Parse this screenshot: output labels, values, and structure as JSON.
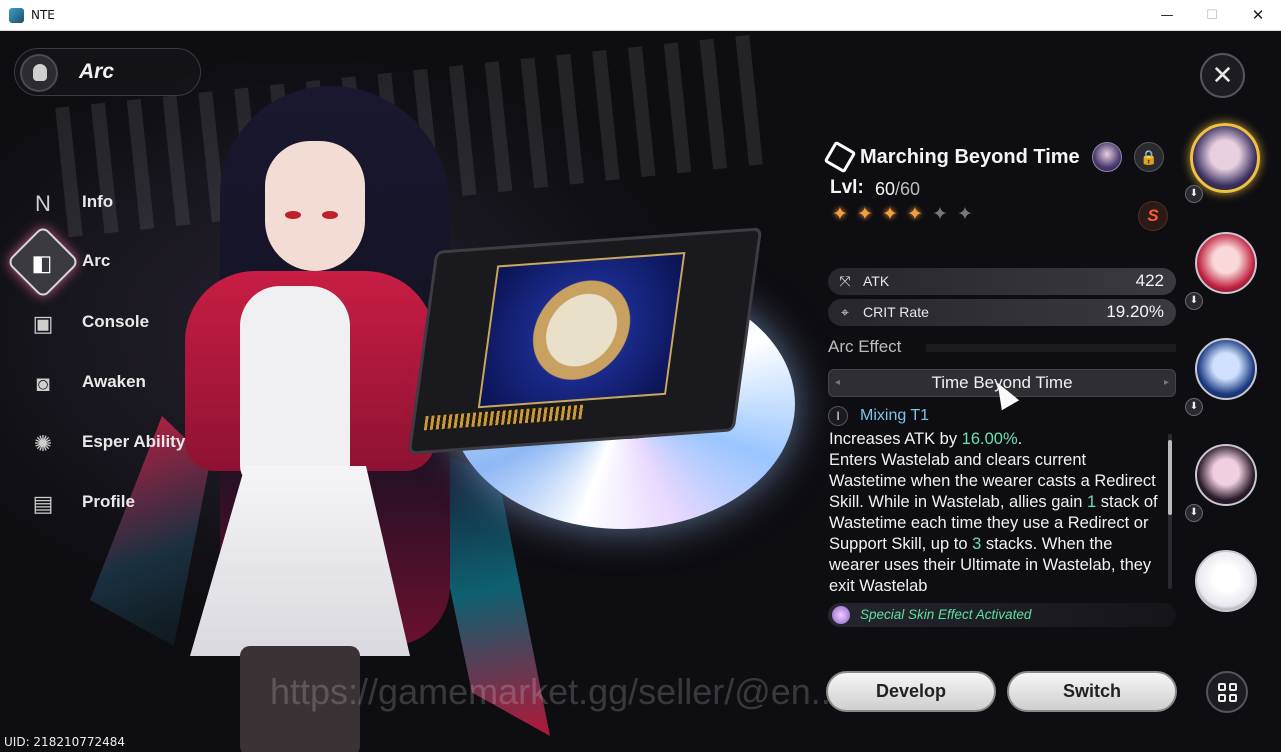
{
  "window": {
    "title": "NTE",
    "minimize": "—",
    "maximize": "☐",
    "close": "✕"
  },
  "character": {
    "name": "Arc"
  },
  "nav": [
    {
      "label": "Info",
      "icon": "info-icon",
      "glyph": "N"
    },
    {
      "label": "Arc",
      "icon": "arc-icon",
      "glyph": "◧"
    },
    {
      "label": "Console",
      "icon": "console-icon",
      "glyph": "▣"
    },
    {
      "label": "Awaken",
      "icon": "awaken-icon",
      "glyph": "◙"
    },
    {
      "label": "Esper Ability",
      "icon": "esper-icon",
      "glyph": "✺"
    },
    {
      "label": "Profile",
      "icon": "profile-icon",
      "glyph": "▤"
    }
  ],
  "arc": {
    "name": "Marching Beyond Time",
    "lvl_label": "Lvl:",
    "lvl_current": "60",
    "lvl_max": "/60",
    "stars_filled": 4,
    "stars_total": 6,
    "rank": "S",
    "lock_glyph": "🔒",
    "stats": [
      {
        "name": "ATK",
        "value": "422",
        "icon": "atk-icon",
        "glyph": "⤧"
      },
      {
        "name": "CRIT Rate",
        "value": "19.20%",
        "icon": "crit-icon",
        "glyph": "⌖"
      }
    ],
    "effect_title": "Arc Effect",
    "effect_name": "Time Beyond Time",
    "tier_glyph": "I",
    "tier_label": "Mixing T1",
    "effect_text_parts": [
      {
        "text": "Increases ATK by ",
        "hl": false
      },
      {
        "text": "16.00%",
        "hl": true
      },
      {
        "text": ".",
        "hl": false
      },
      {
        "text": "\nEnters Wastelab and clears current Wastetime when the wearer casts a Redirect Skill. While in Wastelab, allies gain ",
        "hl": false
      },
      {
        "text": "1",
        "hl": true
      },
      {
        "text": " stack of Wastetime each time they use a Redirect or Support Skill, up to ",
        "hl": false
      },
      {
        "text": "3",
        "hl": true
      },
      {
        "text": " stacks. When the wearer uses their Ultimate in Wastelab, they exit Wastelab",
        "hl": false
      }
    ],
    "skin_effect": "Special Skin Effect Activated"
  },
  "buttons": {
    "develop": "Develop",
    "switch": "Switch",
    "close": "✕"
  },
  "roster": [
    {
      "name": "roster-avatar-1",
      "selected": true,
      "colors": [
        "#3a3060",
        "#e8d0e0"
      ]
    },
    {
      "name": "roster-avatar-2",
      "selected": false,
      "colors": [
        "#c02040",
        "#f8d8d8"
      ]
    },
    {
      "name": "roster-avatar-3",
      "selected": false,
      "colors": [
        "#1a3a80",
        "#d0e0ff"
      ]
    },
    {
      "name": "roster-avatar-4",
      "selected": false,
      "colors": [
        "#2a1a2a",
        "#f0d0e0"
      ]
    },
    {
      "name": "roster-avatar-5",
      "selected": false,
      "colors": [
        "#e8e8f0",
        "#ffffff"
      ]
    }
  ],
  "watermark": "https://gamemarket.gg/seller/@en...es",
  "uid": "UID: 218210772484",
  "colors": {
    "accent_highlight": "#6de0b0",
    "tier_label": "#7cc4ea",
    "star_on": "#f0a040",
    "rank": "#ff5a2a"
  }
}
